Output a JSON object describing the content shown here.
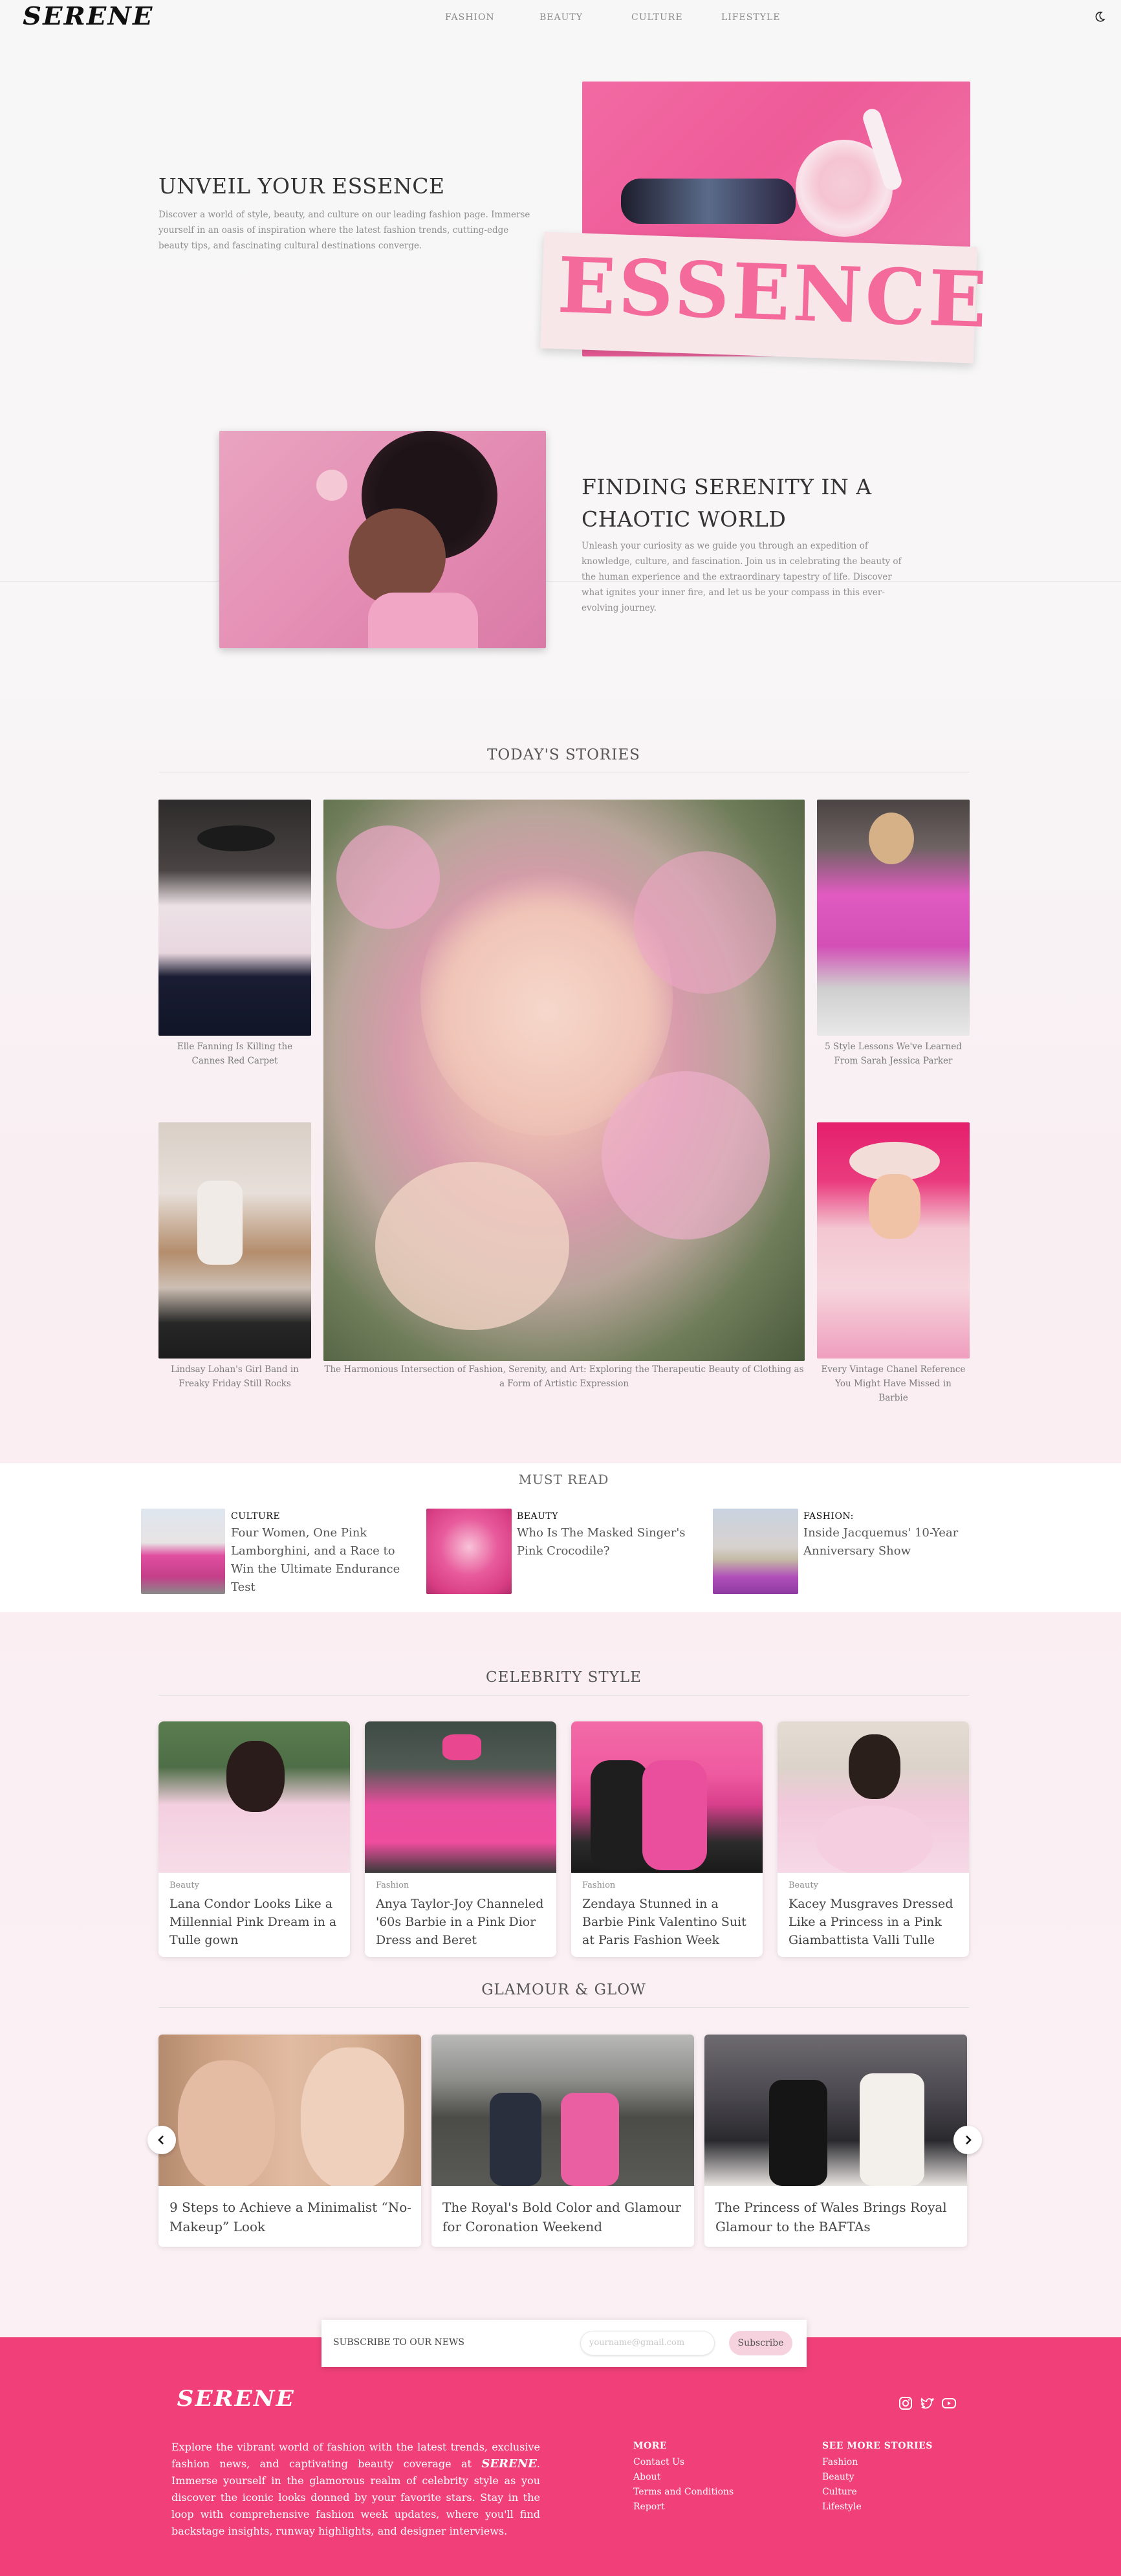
{
  "header": {
    "logo": "SERENE",
    "nav": [
      "FASHION",
      "BEAUTY",
      "CULTURE",
      "LIFESTYLE"
    ],
    "theme_icon": "moon-icon"
  },
  "hero1": {
    "title": "UNVEIL YOUR ESSENCE",
    "text": "Discover a world of style, beauty, and culture on our leading fashion page. Immerse yourself in an oasis of inspiration where the latest fashion trends, cutting-edge beauty tips, and fascinating cultural destinations converge.",
    "image_word": "ESSENCE"
  },
  "hero2": {
    "title": "FINDING SERENITY IN A CHAOTIC WORLD",
    "text": "Unleash your curiosity as we guide you through an expedition of knowledge, culture, and fascination. Join us in celebrating the beauty of the human experience and the extraordinary tapestry of life. Discover what ignites your inner fire, and let us be your compass in this ever-evolving journey."
  },
  "todays_stories": {
    "title": "TODAY'S STORIES",
    "items": [
      "Elle Fanning Is Killing the Cannes Red Carpet",
      "Lindsay Lohan's Girl Band in Freaky Friday Still Rocks",
      "The Harmonious Intersection of Fashion, Serenity, and Art: Exploring the Therapeutic Beauty of Clothing as a Form of Artistic Expression",
      "5 Style Lessons We've Learned From Sarah Jessica Parker",
      "Every Vintage Chanel Reference You Might Have Missed in Barbie"
    ]
  },
  "must_read": {
    "title": "MUST READ",
    "items": [
      {
        "category": "CULTURE",
        "title": "Four Women, One Pink Lamborghini, and a Race to Win the Ultimate Endurance Test"
      },
      {
        "category": "BEAUTY",
        "title": "Who Is The Masked Singer's Pink Crocodile?"
      },
      {
        "category": "FASHION:",
        "title": "Inside Jacquemus' 10-Year Anniversary Show"
      }
    ]
  },
  "celebrity_style": {
    "title": "CELEBRITY STYLE",
    "items": [
      {
        "category": "Beauty",
        "title": "Lana Condor Looks Like a Millennial Pink Dream in a Tulle gown"
      },
      {
        "category": "Fashion",
        "title": "Anya Taylor-Joy Channeled '60s Barbie in a Pink Dior Dress and Beret"
      },
      {
        "category": "Fashion",
        "title": "Zendaya Stunned in a Barbie Pink Valentino Suit at Paris Fashion Week"
      },
      {
        "category": "Beauty",
        "title": "Kacey Musgraves Dressed Like a Princess in a Pink Giambattista Valli Tulle"
      }
    ]
  },
  "glamour": {
    "title": "GLAMOUR & GLOW",
    "items": [
      {
        "title": "9 Steps to Achieve a Minimalist “No-Makeup” Look"
      },
      {
        "title": "The Royal's Bold Color and Glamour for Coronation Weekend"
      },
      {
        "title": "The Princess of Wales Brings Royal Glamour to the BAFTAs"
      }
    ],
    "prev_icon": "chevron-left-icon",
    "next_icon": "chevron-right-icon"
  },
  "subscribe": {
    "label": "SUBSCRIBE TO OUR NEWS",
    "placeholder": "yourname@gmail.com",
    "button": "Subscribe"
  },
  "footer": {
    "logo": "SERENE",
    "text_before": "Explore the vibrant world of fashion with the latest trends, exclusive fashion news, and captivating beauty coverage at",
    "text_logo": "SERENE",
    "text_after": ". Immerse yourself in the glamorous realm of celebrity style as you discover the iconic looks donned by your favorite stars. Stay in the loop with comprehensive fashion week updates, where you'll find backstage insights, runway highlights, and designer interviews.",
    "more_title": "MORE",
    "more_links": [
      "Contact Us",
      "About",
      "Terms and Conditions",
      "Report"
    ],
    "stories_title": "SEE MORE STORIES",
    "stories_links": [
      "Fashion",
      "Beauty",
      "Culture",
      "Lifestyle"
    ],
    "social_icons": [
      "instagram-icon",
      "twitter-icon",
      "youtube-icon"
    ]
  },
  "colors": {
    "accent_pink": "#f14079",
    "subscribe_btn": "#f6d2de"
  }
}
